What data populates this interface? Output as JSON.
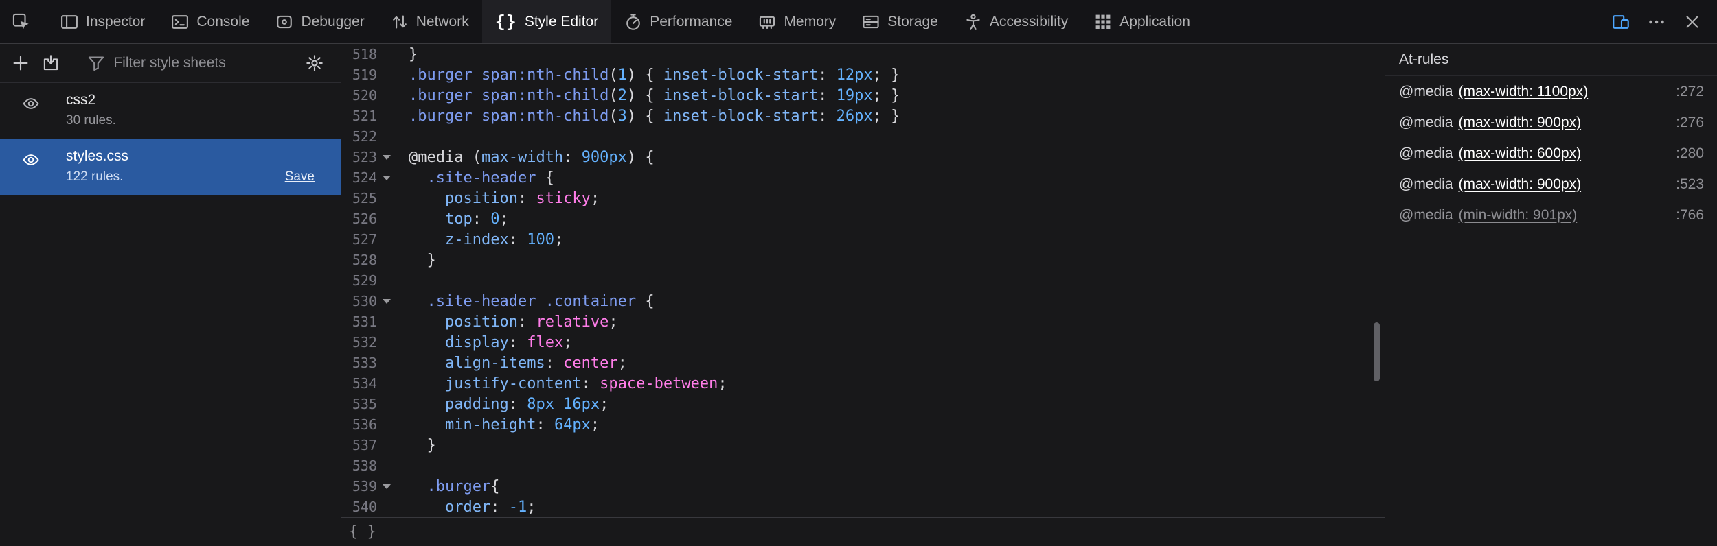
{
  "colors": {
    "toolbar_bg": "#141417",
    "panel_bg": "#18181a",
    "border": "#38383d",
    "selection_blue": "#2a5aa0",
    "accent_blue": "#4da7ff",
    "syntax_selector": "#7e9cf0",
    "syntax_property": "#80b6f7",
    "syntax_value": "#ff7de9",
    "syntax_number": "#64b2ff",
    "text_primary": "#d7d7db",
    "text_secondary": "#8f8f94"
  },
  "toolbar": {
    "picker_icon": "node-picker-icon",
    "tabs": [
      {
        "id": "inspector",
        "label": "Inspector",
        "icon": "inspector-icon"
      },
      {
        "id": "console",
        "label": "Console",
        "icon": "console-icon"
      },
      {
        "id": "debugger",
        "label": "Debugger",
        "icon": "debugger-icon"
      },
      {
        "id": "network",
        "label": "Network",
        "icon": "network-icon"
      },
      {
        "id": "style-editor",
        "label": "Style Editor",
        "icon": "style-editor-icon",
        "selected": true
      },
      {
        "id": "performance",
        "label": "Performance",
        "icon": "performance-icon"
      },
      {
        "id": "memory",
        "label": "Memory",
        "icon": "memory-icon"
      },
      {
        "id": "storage",
        "label": "Storage",
        "icon": "storage-icon"
      },
      {
        "id": "accessibility",
        "label": "Accessibility",
        "icon": "accessibility-icon"
      },
      {
        "id": "application",
        "label": "Application",
        "icon": "application-icon"
      }
    ],
    "right_buttons": [
      {
        "name": "responsive-design-mode-button",
        "icon": "responsive-design-mode-icon",
        "active": true
      },
      {
        "name": "more-tools-button",
        "icon": "more-options-icon",
        "active": false
      },
      {
        "name": "close-devtools-button",
        "icon": "close-icon",
        "active": false
      }
    ]
  },
  "sidebar": {
    "new_button_icon": "add-stylesheet-icon",
    "import_button_icon": "import-stylesheet-icon",
    "filter_icon": "filter-icon",
    "options_icon": "options-gear-icon",
    "visibility_icon": "eye-icon",
    "filter_placeholder": "Filter style sheets",
    "sheets": [
      {
        "name": "css2",
        "rules_label": "30 rules.",
        "selected": false
      },
      {
        "name": "styles.css",
        "rules_label": "122 rules.",
        "selected": true,
        "save_label": "Save"
      }
    ]
  },
  "editor": {
    "footer_label": "{ }",
    "lines": [
      {
        "n": "518",
        "seg": [
          {
            "t": "}",
            "c": "pu"
          }
        ]
      },
      {
        "n": "519",
        "seg": [
          {
            "t": ".burger span:nth-child",
            "c": "se"
          },
          {
            "t": "(",
            "c": "pu"
          },
          {
            "t": "1",
            "c": "nu"
          },
          {
            "t": ")",
            "c": "pu"
          },
          {
            "t": " { ",
            "c": "pu"
          },
          {
            "t": "inset-block-start",
            "c": "pr"
          },
          {
            "t": ": ",
            "c": "pu"
          },
          {
            "t": "12px",
            "c": "nu"
          },
          {
            "t": "; ",
            "c": "pu"
          },
          {
            "t": "}",
            "c": "pu"
          }
        ]
      },
      {
        "n": "520",
        "seg": [
          {
            "t": ".burger span:nth-child",
            "c": "se"
          },
          {
            "t": "(",
            "c": "pu"
          },
          {
            "t": "2",
            "c": "nu"
          },
          {
            "t": ")",
            "c": "pu"
          },
          {
            "t": " { ",
            "c": "pu"
          },
          {
            "t": "inset-block-start",
            "c": "pr"
          },
          {
            "t": ": ",
            "c": "pu"
          },
          {
            "t": "19px",
            "c": "nu"
          },
          {
            "t": "; ",
            "c": "pu"
          },
          {
            "t": "}",
            "c": "pu"
          }
        ]
      },
      {
        "n": "521",
        "seg": [
          {
            "t": ".burger span:nth-child",
            "c": "se"
          },
          {
            "t": "(",
            "c": "pu"
          },
          {
            "t": "3",
            "c": "nu"
          },
          {
            "t": ")",
            "c": "pu"
          },
          {
            "t": " { ",
            "c": "pu"
          },
          {
            "t": "inset-block-start",
            "c": "pr"
          },
          {
            "t": ": ",
            "c": "pu"
          },
          {
            "t": "26px",
            "c": "nu"
          },
          {
            "t": "; ",
            "c": "pu"
          },
          {
            "t": "}",
            "c": "pu"
          }
        ]
      },
      {
        "n": "522",
        "seg": []
      },
      {
        "n": "523",
        "fold": true,
        "seg": [
          {
            "t": "@media ",
            "c": "pu"
          },
          {
            "t": "(",
            "c": "pu"
          },
          {
            "t": "max-width",
            "c": "pr"
          },
          {
            "t": ": ",
            "c": "pu"
          },
          {
            "t": "900px",
            "c": "nu"
          },
          {
            "t": ") {",
            "c": "pu"
          }
        ]
      },
      {
        "n": "524",
        "fold": true,
        "seg": [
          {
            "t": "  ",
            "c": "pu"
          },
          {
            "t": ".site-header",
            "c": "se"
          },
          {
            "t": " {",
            "c": "pu"
          }
        ]
      },
      {
        "n": "525",
        "seg": [
          {
            "t": "    ",
            "c": "pu"
          },
          {
            "t": "position",
            "c": "pr"
          },
          {
            "t": ": ",
            "c": "pu"
          },
          {
            "t": "sticky",
            "c": "va"
          },
          {
            "t": ";",
            "c": "pu"
          }
        ]
      },
      {
        "n": "526",
        "seg": [
          {
            "t": "    ",
            "c": "pu"
          },
          {
            "t": "top",
            "c": "pr"
          },
          {
            "t": ": ",
            "c": "pu"
          },
          {
            "t": "0",
            "c": "nu"
          },
          {
            "t": ";",
            "c": "pu"
          }
        ]
      },
      {
        "n": "527",
        "seg": [
          {
            "t": "    ",
            "c": "pu"
          },
          {
            "t": "z-index",
            "c": "pr"
          },
          {
            "t": ": ",
            "c": "pu"
          },
          {
            "t": "100",
            "c": "nu"
          },
          {
            "t": ";",
            "c": "pu"
          }
        ]
      },
      {
        "n": "528",
        "seg": [
          {
            "t": "  }",
            "c": "pu"
          }
        ]
      },
      {
        "n": "529",
        "seg": []
      },
      {
        "n": "530",
        "fold": true,
        "seg": [
          {
            "t": "  ",
            "c": "pu"
          },
          {
            "t": ".site-header .container",
            "c": "se"
          },
          {
            "t": " {",
            "c": "pu"
          }
        ]
      },
      {
        "n": "531",
        "seg": [
          {
            "t": "    ",
            "c": "pu"
          },
          {
            "t": "position",
            "c": "pr"
          },
          {
            "t": ": ",
            "c": "pu"
          },
          {
            "t": "relative",
            "c": "va"
          },
          {
            "t": ";",
            "c": "pu"
          }
        ]
      },
      {
        "n": "532",
        "seg": [
          {
            "t": "    ",
            "c": "pu"
          },
          {
            "t": "display",
            "c": "pr"
          },
          {
            "t": ": ",
            "c": "pu"
          },
          {
            "t": "flex",
            "c": "va"
          },
          {
            "t": ";",
            "c": "pu"
          }
        ]
      },
      {
        "n": "533",
        "seg": [
          {
            "t": "    ",
            "c": "pu"
          },
          {
            "t": "align-items",
            "c": "pr"
          },
          {
            "t": ": ",
            "c": "pu"
          },
          {
            "t": "center",
            "c": "va"
          },
          {
            "t": ";",
            "c": "pu"
          }
        ]
      },
      {
        "n": "534",
        "seg": [
          {
            "t": "    ",
            "c": "pu"
          },
          {
            "t": "justify-content",
            "c": "pr"
          },
          {
            "t": ": ",
            "c": "pu"
          },
          {
            "t": "space-between",
            "c": "va"
          },
          {
            "t": ";",
            "c": "pu"
          }
        ]
      },
      {
        "n": "535",
        "seg": [
          {
            "t": "    ",
            "c": "pu"
          },
          {
            "t": "padding",
            "c": "pr"
          },
          {
            "t": ": ",
            "c": "pu"
          },
          {
            "t": "8px 16px",
            "c": "nu"
          },
          {
            "t": ";",
            "c": "pu"
          }
        ]
      },
      {
        "n": "536",
        "seg": [
          {
            "t": "    ",
            "c": "pu"
          },
          {
            "t": "min-height",
            "c": "pr"
          },
          {
            "t": ": ",
            "c": "pu"
          },
          {
            "t": "64px",
            "c": "nu"
          },
          {
            "t": ";",
            "c": "pu"
          }
        ]
      },
      {
        "n": "537",
        "seg": [
          {
            "t": "  }",
            "c": "pu"
          }
        ]
      },
      {
        "n": "538",
        "seg": []
      },
      {
        "n": "539",
        "fold": true,
        "seg": [
          {
            "t": "  ",
            "c": "pu"
          },
          {
            "t": ".burger",
            "c": "se"
          },
          {
            "t": "{",
            "c": "pu"
          }
        ]
      },
      {
        "n": "540",
        "seg": [
          {
            "t": "    ",
            "c": "pu"
          },
          {
            "t": "order",
            "c": "pr"
          },
          {
            "t": ": ",
            "c": "pu"
          },
          {
            "t": "-1",
            "c": "nu"
          },
          {
            "t": ";",
            "c": "pu"
          }
        ]
      }
    ]
  },
  "at_rules": {
    "title": "At-rules",
    "items": [
      {
        "prefix": "@media",
        "condition": "(max-width: 1100px)",
        "line_ref": ":272",
        "matched": true
      },
      {
        "prefix": "@media",
        "condition": "(max-width: 900px)",
        "line_ref": ":276",
        "matched": true
      },
      {
        "prefix": "@media",
        "condition": "(max-width: 600px)",
        "line_ref": ":280",
        "matched": true
      },
      {
        "prefix": "@media",
        "condition": "(max-width: 900px)",
        "line_ref": ":523",
        "matched": true
      },
      {
        "prefix": "@media",
        "condition": "(min-width: 901px)",
        "line_ref": ":766",
        "matched": false
      }
    ]
  }
}
